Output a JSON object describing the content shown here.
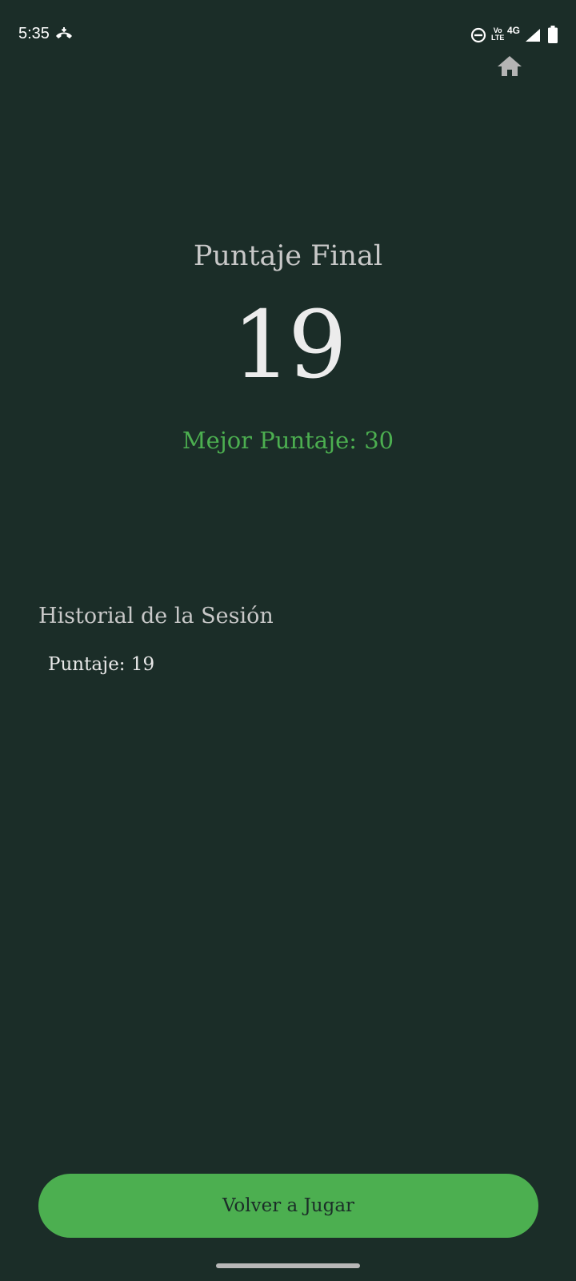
{
  "status_bar": {
    "time": "5:35",
    "volte_top": "Vo",
    "volte_bottom": "LTE",
    "network": "4G",
    "icons": [
      "call-icon",
      "do-not-disturb-icon",
      "volte-icon",
      "signal-icon",
      "battery-icon"
    ]
  },
  "header": {
    "home_icon": "home-icon"
  },
  "score": {
    "title": "Puntaje Final",
    "value": "19",
    "best": "Mejor Puntaje: 30"
  },
  "history": {
    "title": "Historial de la Sesión",
    "items": [
      "Puntaje: 19"
    ]
  },
  "actions": {
    "play_again_label": "Volver a Jugar"
  },
  "colors": {
    "background": "#1b2d28",
    "accent": "#4caf50",
    "text_primary": "#ececec",
    "text_secondary": "#c8c8c8"
  }
}
